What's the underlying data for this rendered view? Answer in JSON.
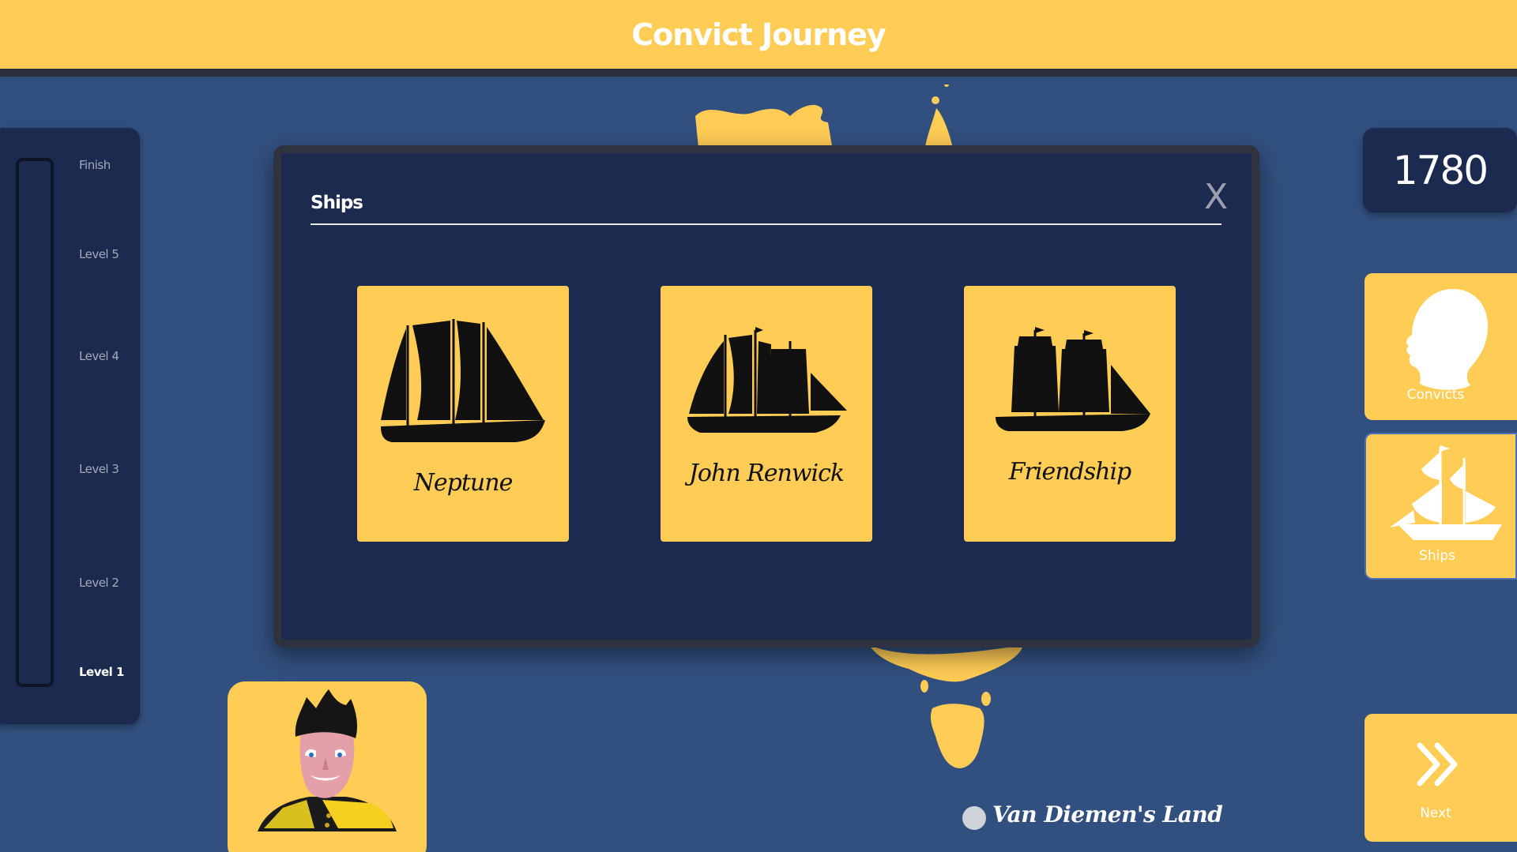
{
  "header": {
    "title": "Convict Journey"
  },
  "map": {
    "place_label": "Van Diemen's Land"
  },
  "levels": [
    {
      "label": "Finish",
      "active": false
    },
    {
      "label": "Level 5",
      "active": false
    },
    {
      "label": "Level 4",
      "active": false
    },
    {
      "label": "Level 3",
      "active": false
    },
    {
      "label": "Level 2",
      "active": false
    },
    {
      "label": "Level 1",
      "active": true
    }
  ],
  "year": "1780",
  "side_buttons": {
    "convicts": {
      "label": "Convicts",
      "icon": "head-silhouette-icon"
    },
    "ships": {
      "label": "Ships",
      "icon": "ship-icon"
    },
    "next": {
      "label": "Next",
      "icon": "double-chevron-right-icon"
    }
  },
  "modal": {
    "title": "Ships",
    "close_label": "X",
    "ships": [
      {
        "name": "Neptune",
        "icon": "schooner-silhouette-icon"
      },
      {
        "name": "John Renwick",
        "icon": "frigate-silhouette-icon"
      },
      {
        "name": "Friendship",
        "icon": "brig-silhouette-icon"
      }
    ]
  },
  "colors": {
    "accent": "#ffcc55",
    "panel": "#1c2a50",
    "sea": "#32507f",
    "header_border": "#2a2f3b"
  }
}
